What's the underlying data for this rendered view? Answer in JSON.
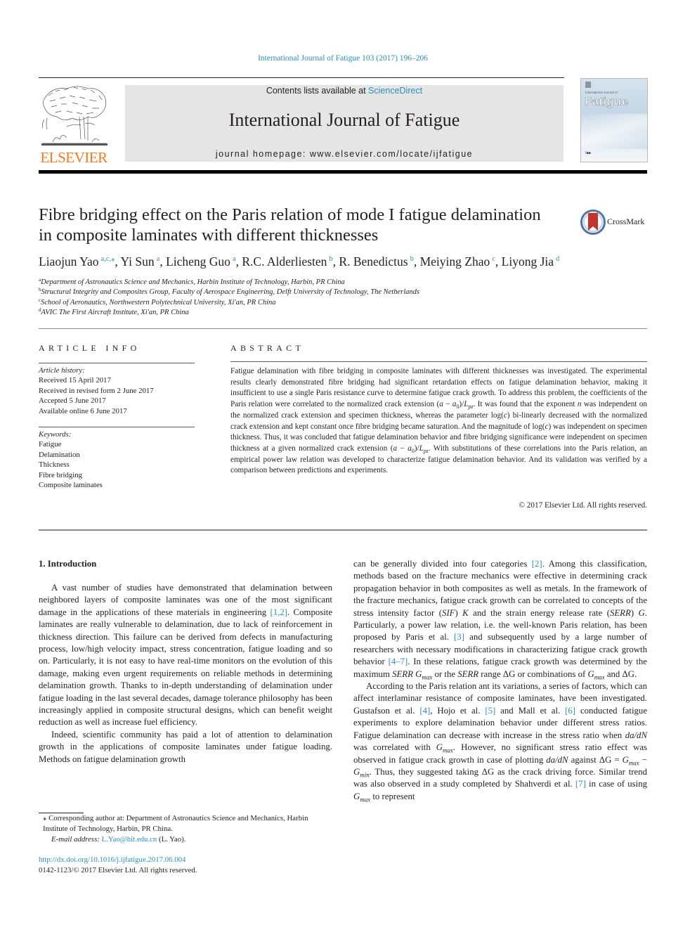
{
  "header": {
    "citation": "International Journal of Fatigue 103 (2017) 196–206",
    "contents_prefix": "Contents lists available at ",
    "contents_link": "ScienceDirect",
    "journal_name": "International Journal of Fatigue",
    "homepage_label": "journal homepage: ",
    "homepage_url": "www.elsevier.com/locate/ijfatigue",
    "publisher_logo_text": "ELSEVIER",
    "cover": {
      "small_text": "International Journal of",
      "title": "Fatigue"
    },
    "crossmark_label": "CrossMark"
  },
  "article": {
    "title_line1": "Fibre bridging effect on the Paris relation of mode I fatigue delamination",
    "title_line2": "in composite laminates with different thicknesses",
    "authors": [
      {
        "name": "Liaojun Yao",
        "sup": "a,c,⁎",
        "sep": ", "
      },
      {
        "name": "Yi Sun",
        "sup": "a",
        "sep": ", "
      },
      {
        "name": "Licheng Guo",
        "sup": "a",
        "sep": ", "
      },
      {
        "name": "R.C. Alderliesten",
        "sup": "b",
        "sep": ", "
      },
      {
        "name": "R. Benedictus",
        "sup": "b",
        "sep": ", "
      },
      {
        "name": "Meiying Zhao",
        "sup": "c",
        "sep": ", "
      },
      {
        "name": "Liyong Jia",
        "sup": "d",
        "sep": ""
      }
    ],
    "affiliations": [
      {
        "key": "a",
        "text": "Department of Astronautics Science and Mechanics, Harbin Institute of Technology, Harbin, PR China"
      },
      {
        "key": "b",
        "text": "Structural Integrity and Composites Group, Faculty of Aerospace Engineering, Delft University of Technology, The Netherlands"
      },
      {
        "key": "c",
        "text": "School of Aeronautics, Northwestern Polytechnical University, Xi'an, PR China"
      },
      {
        "key": "d",
        "text": "AVIC The First Aircraft Institute, Xi'an, PR China"
      }
    ]
  },
  "article_info": {
    "heading": "ARTICLE INFO",
    "history_label": "Article history:",
    "history": [
      "Received 15 April 2017",
      "Received in revised form 2 June 2017",
      "Accepted 5 June 2017",
      "Available online 6 June 2017"
    ],
    "keywords_label": "Keywords:",
    "keywords": [
      "Fatigue",
      "Delamination",
      "Thickness",
      "Fibre bridging",
      "Composite laminates"
    ]
  },
  "abstract": {
    "heading": "ABSTRACT",
    "p1": "Fatigue delamination with fibre bridging in composite laminates with different thicknesses was investigated. The experimental results clearly demonstrated fibre bridging had significant retardation effects on fatigue delamination behavior, making it insufficient to use a single Paris resistance curve to determine fatigue crack growth. To address this problem, the coefficients of the Paris relation were correlated to the normalized crack extension ",
    "expr1": "(a − a0)/Lpz",
    "p2": ". It was found that the exponent ",
    "n": "n",
    "p3": " was independent on the normalized crack extension and specimen thickness, whereas the parameter log(",
    "c": "c",
    "p4": ") bi-linearly decreased with the normalized crack extension and kept constant once fibre bridging became saturation. And the magnitude of log(",
    "p5": ") was independent on specimen thickness. Thus, it was concluded that fatigue delamination behavior and fibre bridging significance were independent on specimen thickness at a given normalized crack extension ",
    "p6": ". With substitutions of these correlations into the Paris relation, an empirical power law relation was developed to characterize fatigue delamination behavior. And its validation was verified by a comparison between predictions and experiments.",
    "copyright": "© 2017 Elsevier Ltd. All rights reserved."
  },
  "body": {
    "section_heading": "1. Introduction",
    "left": {
      "p1a": "A vast number of studies have demonstrated that delamination between neighbored layers of composite laminates was one of the most significant damage in the applications of these materials in engineering ",
      "ref12": "[1,2]",
      "p1b": ". Composite laminates are really vulnerable to delamination, due to lack of reinforcement in thickness direction. This failure can be derived from defects in manufacturing process, low/high velocity impact, stress concentration, fatigue loading and so on. Particularly, it is not easy to have real-time monitors on the evolution of this damage, making even urgent requirements on reliable methods in determining delamination growth. Thanks to in-depth understanding of delamination under fatigue loading in the last several decades, damage tolerance philosophy has been increasingly applied in composite structural designs, which can benefit weight reduction as well as increase fuel efficiency.",
      "p2": "Indeed, scientific community has paid a lot of attention to delamination growth in the applications of composite laminates under fatigue loading. Methods on fatigue delamination growth"
    },
    "right": {
      "p1a": "can be generally divided into four categories ",
      "ref2": "[2]",
      "p1b": ". Among this classification, methods based on the fracture mechanics were effective in determining crack propagation behavior in both composites as well as metals. In the framework of the fracture mechanics, fatigue crack growth can be correlated to concepts of the stress intensity factor (",
      "sif": "SIF",
      "p1c": ") ",
      "K": "K",
      "p1d": " and the strain energy release rate (",
      "serr": "SERR",
      "p1e": ") ",
      "G": "G",
      "p1f": ". Particularly, a power law relation, i.e. the well-known Paris relation, has been proposed by Paris et al. ",
      "ref3": "[3]",
      "p1g": " and subsequently used by a large number of researchers with necessary modifications in characterizing fatigue crack growth behavior ",
      "ref47": "[4–7]",
      "p1h": ". In these relations, fatigue crack growth was determined by the maximum ",
      "p1i": " or the ",
      "p1j": " range ΔG or combinations of ",
      "p1k": " and ΔG.",
      "p2a": "According to the Paris relation ant its variations, a series of factors, which can affect interlaminar resistance of composite laminates, have been investigated. Gustafson et al. ",
      "ref4": "[4]",
      "p2b": ", Hojo et al. ",
      "ref5": "[5]",
      "p2c": " and Mall et al. ",
      "ref6": "[6]",
      "p2d": " conducted fatigue experiments to explore delamination behavior under different stress ratios. Fatigue delamination can decrease with increase in the stress ratio when ",
      "dadn": "da/dN",
      "p2e": " was correlated with ",
      "p2f": ". However, no significant stress ratio effect was observed in fatigue crack growth in case of plotting ",
      "p2g": " against ΔG = ",
      "p2h": " − ",
      "p2i": ". Thus, they suggested taking ΔG as the crack driving force. Similar trend was also observed in a study completed by Shahverdi et al. ",
      "ref7": "[7]",
      "p2j": " in case of using ",
      "p2k": " to represent"
    },
    "footnote": {
      "corresponding": "⁎ Corresponding author at: Department of Astronautics Science and Mechanics, Harbin Institute of Technology, Harbin, PR China.",
      "email_label": "E-mail address: ",
      "email": "L.Yao@hit.edu.cn",
      "email_suffix": " (L. Yao)."
    },
    "doi": "http://dx.doi.org/10.1016/j.ijfatigue.2017.06.004",
    "issn_line": "0142-1123/© 2017 Elsevier Ltd. All rights reserved."
  },
  "colors": {
    "link": "#2a8fbd",
    "elsevier_orange": "#f47a20",
    "masthead_gray": "#e5e5e5",
    "text": "#231f20"
  }
}
